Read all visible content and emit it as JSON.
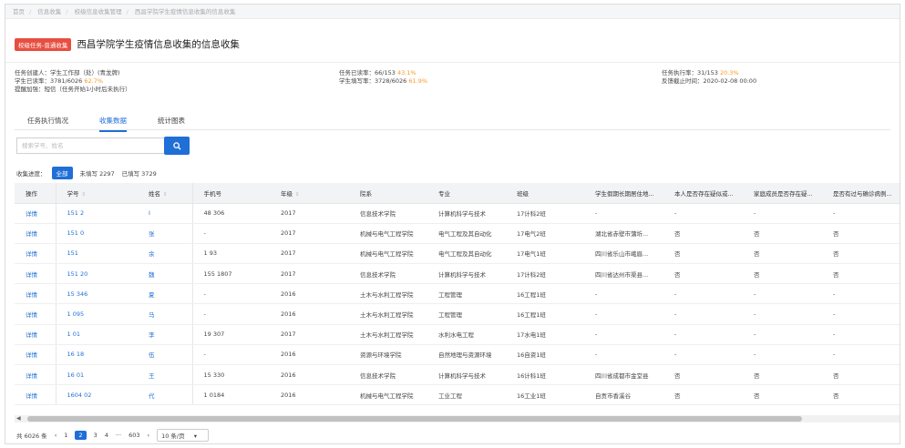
{
  "breadcrumb": [
    "首页",
    "信息收集",
    "校级信息收集管理",
    "西昌学院学生疫情信息收集的信息收集"
  ],
  "task": {
    "tag": "校级任务-普通收集",
    "title": "西昌学院学生疫情信息收集的信息收集"
  },
  "info": {
    "creator": "任务创建人：学生工作部（处）(青龙牌)",
    "task_read_label": "任务已读率：66/153",
    "task_read_pct": "43.1%",
    "task_exec_label": "任务执行率：31/153",
    "task_exec_pct": "20.3%",
    "student_read_label": "学生已读率：3781/6026",
    "student_read_pct": "62.7%",
    "student_fill": "学生填写率：3728/6026",
    "student_fill_pct": "61.9%",
    "deadline": "反馈截止时间：2020-02-08 00:00",
    "reminder": "提醒加强：短信（任务开始1小时后未执行）"
  },
  "tabs": [
    "任务执行情况",
    "收集数据",
    "统计图表"
  ],
  "search": {
    "placeholder": "搜索学号、姓名"
  },
  "progress": {
    "label": "收集进度：",
    "all": "全部",
    "unfilled": "未填写 2297",
    "filled": "已填写 3729"
  },
  "table": {
    "headers": [
      "操作",
      "学号",
      "姓名",
      "手机号",
      "年级",
      "院系",
      "专业",
      "班级",
      "学生假期长期居住地...",
      "本人是否存在疑似或...",
      "家庭成员是否存在疑...",
      "是否有过与确诊病例..."
    ],
    "rows": [
      [
        "详情",
        "151 2",
        "I",
        "48 306",
        "2017",
        "信息技术学院",
        "计算机科学与技术",
        "17计科2班",
        "-",
        "-",
        "-",
        "-"
      ],
      [
        "详情",
        "151 0",
        "张",
        "-",
        "2017",
        "机械与电气工程学院",
        "电气工程及其自动化",
        "17电气2班",
        "湖北省赤壁市蒲圻...",
        "否",
        "否",
        "否"
      ],
      [
        "详情",
        "151",
        "余",
        "1 93",
        "2017",
        "机械与电气工程学院",
        "电气工程及其自动化",
        "17电气1班",
        "四川省乐山市峨眉...",
        "否",
        "否",
        "否"
      ],
      [
        "详情",
        "151 20",
        "魏",
        "155 1807",
        "2017",
        "信息技术学院",
        "计算机科学与技术",
        "17计科2班",
        "四川省达州市渠县...",
        "否",
        "否",
        "否"
      ],
      [
        "详情",
        "15 346",
        "夏",
        "-",
        "2016",
        "土木与水利工程学院",
        "工程管理",
        "16工程1班",
        "-",
        "-",
        "-",
        "-"
      ],
      [
        "详情",
        "1 095",
        "马",
        "-",
        "2016",
        "土木与水利工程学院",
        "工程管理",
        "16工程1班",
        "-",
        "-",
        "-",
        "-"
      ],
      [
        "详情",
        "1 01",
        "李",
        "19 307",
        "2017",
        "土木与水利工程学院",
        "水利水电工程",
        "17水电1班",
        "-",
        "-",
        "-",
        "-"
      ],
      [
        "详情",
        "16 18",
        "伍",
        "-",
        "2016",
        "资源与环境学院",
        "自然地理与资源环境",
        "16自资1班",
        "-",
        "-",
        "-",
        "-"
      ],
      [
        "详情",
        "16 01",
        "王",
        "15 330",
        "2016",
        "信息技术学院",
        "计算机科学与技术",
        "16计科1班",
        "四川省成都市金堂县",
        "否",
        "否",
        "否"
      ],
      [
        "详情",
        "1604 02",
        "代",
        "1 0184",
        "2016",
        "机械与电气工程学院",
        "工业工程",
        "16工业1班",
        "自贡市香溪谷",
        "否",
        "否",
        "否"
      ]
    ]
  },
  "pager": {
    "total": "共 6026 条",
    "pages": [
      "1",
      "2",
      "3",
      "4",
      "···",
      "603"
    ],
    "current": "2",
    "size": "10 条/页"
  },
  "colors": {
    "accent": "#1f6fd6",
    "tag": "#e84e40",
    "highlight": "#f59a23"
  }
}
